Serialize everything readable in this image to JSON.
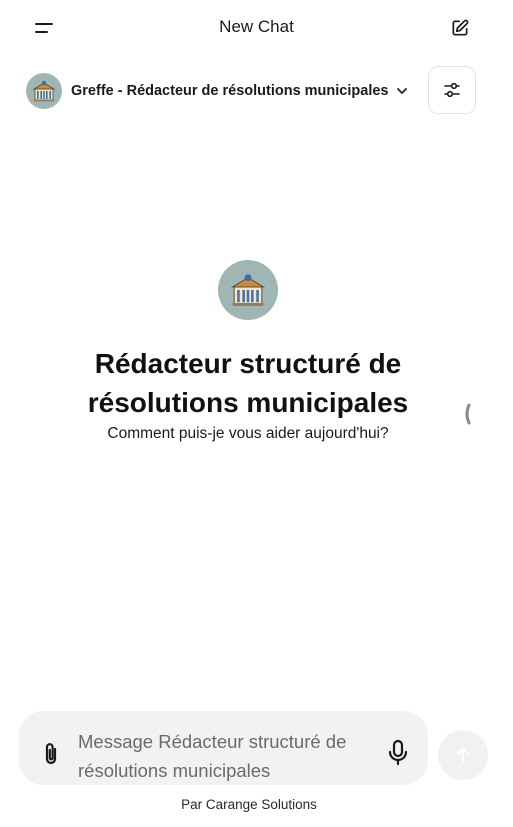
{
  "header": {
    "title": "New Chat",
    "menu_icon": "menu-icon",
    "new_chat_icon": "edit-icon"
  },
  "model_selector": {
    "name": "Greffe - Rédacteur de résolutions municipales",
    "avatar_icon": "city-hall-icon",
    "dropdown_icon": "chevron-down-icon",
    "settings_icon": "sliders-icon"
  },
  "hero": {
    "title": "Rédacteur structuré de résolutions municipales",
    "subtitle": "Comment puis-je vous aider aujourd'hui?"
  },
  "composer": {
    "placeholder": "Message Rédacteur structuré de résolutions municipales",
    "value": "",
    "attach_icon": "paperclip-icon",
    "mic_icon": "microphone-icon",
    "send_icon": "arrow-up-icon"
  },
  "footer": {
    "text": "Par Carange Solutions"
  },
  "colors": {
    "avatar_bg": "#9fb6b5",
    "composer_bg": "#f2f2f2",
    "send_bg": "#f1f1f1"
  }
}
